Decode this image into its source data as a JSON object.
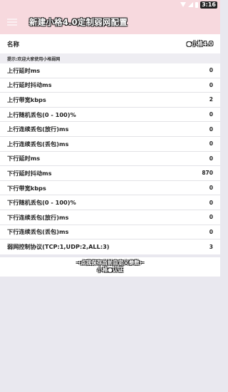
{
  "status_bar": {
    "time": "3:16"
  },
  "app_bar": {
    "title": "新建小格4.0定制弱网配置"
  },
  "name_row": {
    "label": "名称",
    "value": "●小格4.0"
  },
  "tip": "提示:欢迎大家使用小格弱网",
  "params": [
    {
      "label": "上行延时ms",
      "value": "0"
    },
    {
      "label": "上行延时抖动ms",
      "value": "0"
    },
    {
      "label": "上行带宽kbps",
      "value": "2"
    },
    {
      "label": "上行随机丢包(0 - 100)%",
      "value": "0"
    },
    {
      "label": "上行连续丢包(放行)ms",
      "value": "0"
    },
    {
      "label": "上行连续丢包(丢包)ms",
      "value": "0"
    },
    {
      "label": "下行延时ms",
      "value": "0"
    },
    {
      "label": "下行延时抖动ms",
      "value": "870"
    },
    {
      "label": "下行带宽kbps",
      "value": "0"
    },
    {
      "label": "下行随机丢包(0 - 100)%",
      "value": "0"
    },
    {
      "label": "下行连续丢包(放行)ms",
      "value": "0"
    },
    {
      "label": "下行连续丢包(丢包)ms",
      "value": "0"
    },
    {
      "label": "弱网控制协议(TCP:1,UDP:2,ALL:3)",
      "value": "3"
    }
  ],
  "footer": {
    "save_text": "→点我保存当前自定义参数←",
    "credit": "小格●认证"
  }
}
